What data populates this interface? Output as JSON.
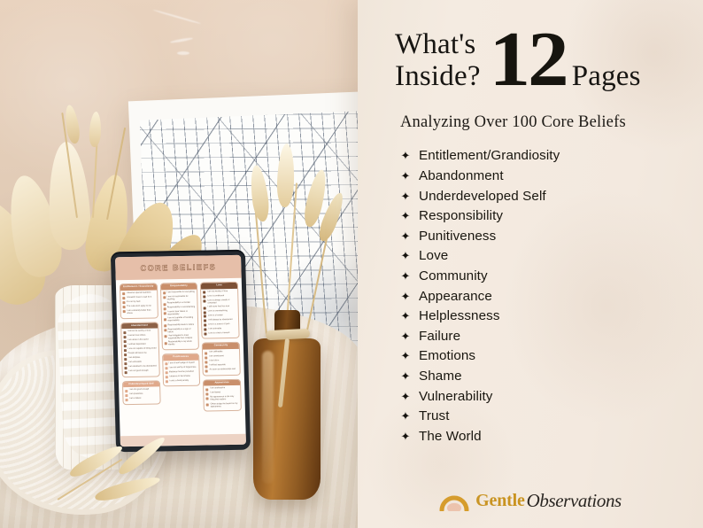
{
  "colors": {
    "panel_bg": "#f3e9df",
    "ink": "#171512",
    "logo_gold": "#c9931f",
    "logo_dark": "#2a2622",
    "worksheet_header": "#e6bfa9",
    "card_brown": "#8d6247",
    "card_tan": "#c98f6b",
    "card_clay": "#e0a98b"
  },
  "panel": {
    "headline_line1": "What's",
    "headline_line2": "Inside?",
    "big_number": "12",
    "pages_label": "Pages",
    "subtitle": "Analyzing Over 100 Core Beliefs",
    "bullet_glyph": "✦",
    "items": [
      {
        "label": "Entitlement/Grandiosity"
      },
      {
        "label": "Abandonment"
      },
      {
        "label": "Underdeveloped Self"
      },
      {
        "label": "Responsibility"
      },
      {
        "label": "Punitiveness"
      },
      {
        "label": "Love"
      },
      {
        "label": "Community"
      },
      {
        "label": "Appearance"
      },
      {
        "label": "Helplessness"
      },
      {
        "label": "Failure"
      },
      {
        "label": "Emotions"
      },
      {
        "label": "Shame"
      },
      {
        "label": "Vulnerability"
      },
      {
        "label": "Trust"
      },
      {
        "label": "The World"
      }
    ]
  },
  "logo": {
    "mark": "sunrise-arch-icon",
    "word_primary": "Gentle",
    "word_secondary": "Observations"
  },
  "photo": {
    "alt": "dried-floral-still-life-with-tablet",
    "tablet": {
      "worksheet_title": "CORE BELIEFS",
      "columns": [
        {
          "cards": [
            {
              "heading": "Entitlement / Grandiosity",
              "color": "#c98f6b",
              "rows": [
                "I deserve special treatment",
                "I shouldn't have to wait for it",
                "It's not my fault",
                "The rules don't apply to me",
                "I am constantly better than others"
              ]
            },
            {
              "heading": "Abandonment",
              "color": "#8d6247",
              "rows": [
                "I will not be worthy of love",
                "I cannot trust others",
                "I am alone in the world",
                "I will feel dependent",
                "I am not capable of being loved",
                "People will leave me",
                "I am helpless",
                "I am unlovable",
                "I am destined to be abandoned",
                "I am not good enough"
              ]
            },
            {
              "heading": "Underdeveloped Self",
              "color": "#e0a98b",
              "rows": [
                "I am not good enough",
                "I am powerless",
                "I am a failure"
              ]
            }
          ]
        },
        {
          "cards": [
            {
              "heading": "Responsibility",
              "color": "#c98f6b",
              "rows": [
                "I am responsible for everything",
                "I am not responsible for anything",
                "Responsibility is a burden",
                "Responsibility is overwhelming",
                "I cannot bear failure or responsibility",
                "I am not capable of handling responsibility",
                "Responsibility leads to failure",
                "Responsibility is a sign of failure",
                "I feel obligated to meet responsibility then collapse",
                "Responsibility is my whole identity"
              ]
            },
            {
              "heading": "Punitiveness",
              "color": "#e0a98b",
              "rows": [
                "I am a harsh judge of myself",
                "I am not worthy of forgiveness",
                "Mistakes must be punished",
                "I deserve to feel shame",
                "I carry a fixed penalty"
              ]
            }
          ]
        },
        {
          "cards": [
            {
              "heading": "Love",
              "color": "#7d5136",
              "rows": [
                "I am not worthy of love",
                "Love is conditional",
                "Love is always unsafe or unwanted",
                "I will never find true love",
                "Love is overwhelming",
                "Love is a burden",
                "I will always be abandoned",
                "Love is a source of pain",
                "I am unlovable",
                "Love is a trial or reward"
              ]
            },
            {
              "heading": "Community",
              "color": "#c98f6b",
              "rows": [
                "I am unlikeable",
                "I am unwelcome",
                "I don't fit in",
                "I will feel separate",
                "As soon as relationships end"
              ]
            },
            {
              "heading": "Appearance",
              "color": "#c98f6b",
              "rows": [
                "I am unattractive",
                "I am flawed",
                "My appearance is the only thing that matters",
                "Others judge me based on my appearance"
              ]
            }
          ]
        }
      ]
    }
  }
}
